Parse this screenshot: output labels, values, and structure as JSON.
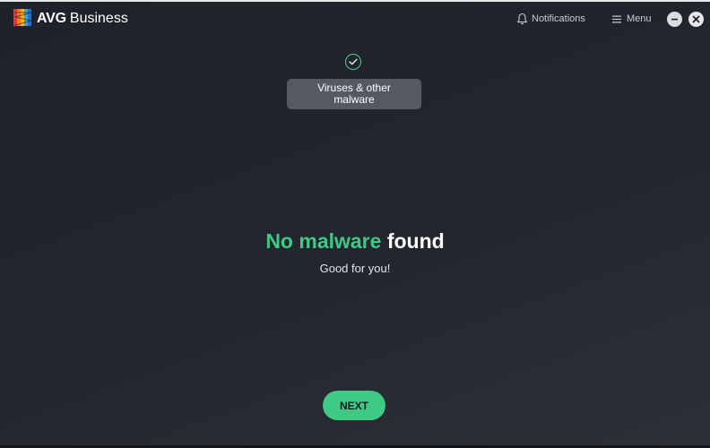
{
  "app": {
    "brand_name": "AVG",
    "brand_suffix": "Business"
  },
  "header": {
    "notifications_label": "Notifications",
    "menu_label": "Menu",
    "icons": {
      "notifications": "bell-icon",
      "menu": "hamburger-icon",
      "minimize": "minimize-icon",
      "close": "close-icon"
    }
  },
  "scan": {
    "completed_step_label": "Viruses & other malware",
    "step_status_icon": "check-icon"
  },
  "result": {
    "title_highlight": "No malware",
    "title_rest": "found",
    "subtitle": "Good for you!"
  },
  "actions": {
    "next_label": "NEXT"
  },
  "colors": {
    "accent_green": "#3ec985",
    "background": "#23262e",
    "pill": "#545963"
  }
}
